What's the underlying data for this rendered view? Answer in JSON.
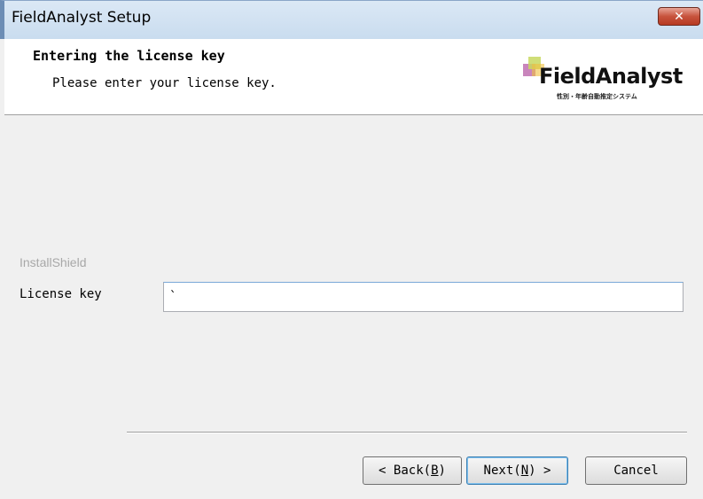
{
  "window": {
    "title": "FieldAnalyst Setup",
    "close_icon": "close-icon (✕)"
  },
  "banner": {
    "title": "Entering the license key",
    "subtitle": "Please enter your license key.",
    "logo_text": "FieldAnalyst",
    "logo_subtext": "性別・年齢自動推定システム",
    "logo_colors": [
      "#c8d860",
      "#c070b0",
      "#70b0d8",
      "#f0c040"
    ]
  },
  "body": {
    "installshield_label": "InstallShield",
    "license_label": "License key",
    "license_value": "`"
  },
  "buttons": {
    "back_prefix": "< Back(",
    "back_key": "B",
    "back_suffix": ")",
    "next_prefix": "Next(",
    "next_key": "N",
    "next_suffix": ") >",
    "cancel": "Cancel"
  }
}
